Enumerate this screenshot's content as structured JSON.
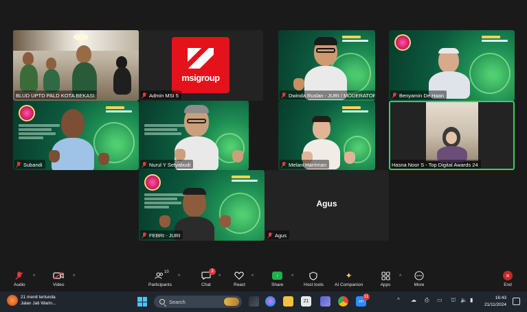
{
  "participants": [
    {
      "name": "BLUD UPTD PALD KOTA BEKASI",
      "muted": false
    },
    {
      "name": "Admin MSI 5",
      "muted": true,
      "logo_text": "msigroup"
    },
    {
      "name": "Dwinda Ruslan - JURI / MODERATOR",
      "muted": true
    },
    {
      "name": "Benyamin De Haan",
      "muted": true
    },
    {
      "name": "Subandi",
      "muted": true
    },
    {
      "name": "Nurul Y Setyabudi",
      "muted": true
    },
    {
      "name": "Melani Harriman",
      "muted": true
    },
    {
      "name": "Hasna Noor S - Top Digital Awards 24",
      "muted": false
    },
    {
      "name": "FEBRI - JURI",
      "muted": true
    },
    {
      "name": "Agus",
      "muted": true,
      "display": "Agus"
    }
  ],
  "toolbar": {
    "audio": "Audio",
    "video": "Video",
    "participants": "Participants",
    "participants_count": "10",
    "chat": "Chat",
    "chat_badge": "3",
    "react": "React",
    "share": "Share",
    "host_tools": "Host tools",
    "ai_companion": "AI Companion",
    "apps": "Apps",
    "more": "More",
    "end": "End"
  },
  "taskbar": {
    "weather_line1": "21 menit tertunda",
    "weather_line2": "Jalan Jati Warin...",
    "search_placeholder": "Search",
    "calendar_day": "21",
    "zoom_badge": "11",
    "time": "16:43",
    "date": "21/11/2024"
  },
  "colors": {
    "active_border": "#37d356",
    "muted_red": "#e23b3b",
    "end_red": "#c62828",
    "share_green": "#1fb24a",
    "brand_red": "#e3121b"
  }
}
